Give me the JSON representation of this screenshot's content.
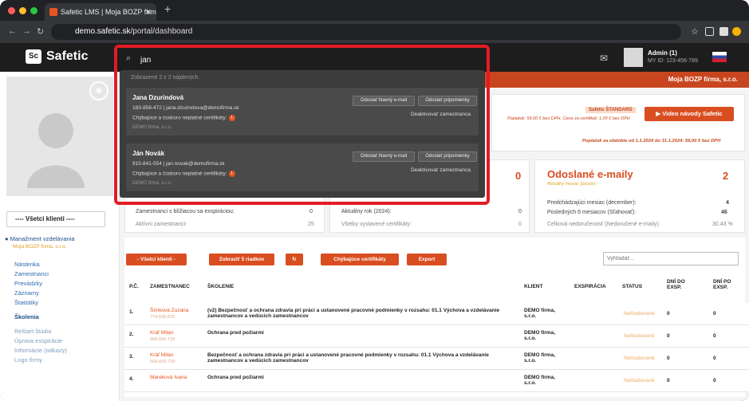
{
  "browser": {
    "tab_title": "Safetic LMS | Moja BOZP firm",
    "url_domain": "demo.safetic.sk",
    "url_path": "/portal/dashboard"
  },
  "header": {
    "logo": "Safetic",
    "admin_name": "Admin (1)",
    "admin_id": "MY ID: 123-456-789",
    "company": "Moja BOZP firma, s.r.o."
  },
  "search": {
    "query": "jan",
    "found_text": "Zobrazené 2 z 2 nájdených.",
    "results": [
      {
        "name": "Jana Dzurindová",
        "contact": "183-858-472 | jana.dzurindova@demofirma.sk",
        "certs_label": "Chýbajúce a čoskoro neplatné certifikáty:",
        "badge": "1",
        "company": "DEMO firma, s.r.o.",
        "btn_email": "Odoslať hlavný e-mail",
        "btn_reminder": "Odoslať pripomienky",
        "deactivate": "Deaktivovať zamestnanca"
      },
      {
        "name": "Ján Novák",
        "contact": "915-841-554 | jan.novak@demofirma.sk",
        "certs_label": "Chýbajúce a čoskoro neplatné certifikáty:",
        "badge": "1",
        "company": "DEMO firma, s.r.o.",
        "btn_email": "Odoslať hlavný e-mail",
        "btn_reminder": "Odoslať pripomienky",
        "deactivate": "Deaktivovať zamestnanca"
      }
    ]
  },
  "sidebar": {
    "client_select": "---- Všetci klienti ----",
    "mgmt_title": "Manažment vzdelávania",
    "mgmt_sub": "Moja BOZP firma, s.r.o.",
    "nav": [
      "Nástenka",
      "Zamestnanci",
      "Prevádzky",
      "Záznamy",
      "Štatistiky",
      "Školenia",
      "Reštart štúdia",
      "Úprava exspirácie",
      "Informácie (odkazy)",
      "Logo firmy"
    ]
  },
  "summary": {
    "package": "Safetic ŠTANDARD",
    "video_btn": "Video návody Safetic",
    "fee_line": "Poplatok: 59,00 € bez DPH, Cena za certifikát: 1,00 € bez DPH",
    "period_line": "Poplatok za obdobie od 1.1.2024 do 31.1.2024: 59,00 € bez DPH",
    "left_count": "0",
    "emails_title": "Odoslané e-maily",
    "emails_count": "2",
    "emails_sub": "Aktuálny mesiac (január)",
    "rows_left": [
      {
        "label": "Zamestnanci s blížiacou sa exspiráciou:",
        "value": "0"
      },
      {
        "label": "Aktívni zamestnanci:",
        "value": "25"
      }
    ],
    "rows_mid": [
      {
        "label": "Aktuálny rok (2024):",
        "value": "0"
      },
      {
        "label": "Všetky vystavené certifikáty:",
        "value": "0"
      }
    ],
    "rows_right": [
      {
        "label": "Predchádzajúci mesiac (december):",
        "value": "4"
      },
      {
        "label": "Posledných 6 mesiacov (Sťahovať):",
        "value": "46"
      },
      {
        "label": "Celková nedoručenosť (Nedoručené e-maily):",
        "value": "30.43 %"
      }
    ]
  },
  "toolbar": {
    "clients": "- Všetci klienti -",
    "show_rows": "Zobraziť 5 riadkov",
    "refresh": "↻",
    "missing": "Chýbajúce certifikáty",
    "export": "Export",
    "search_placeholder": "Vyhľadať..."
  },
  "table": {
    "headers": [
      "P.Č.",
      "ZAMESTNANEC",
      "ŠKOLENIE",
      "KLIENT",
      "EXSPIRÁCIA",
      "STATUS",
      "DNÍ DO EXSP.",
      "DNÍ PO EXSP."
    ],
    "rows": [
      {
        "num": "1.",
        "name": "Šimková Zuzana",
        "phone": "774-535-875",
        "training": "(v2) Bezpečnosť a ochrana zdravia pri práci a ustanovené pracovné podmienky v rozsahu: 01.1 Výchova a vzdelávanie zamestnancov a vedúcich zamestnancov",
        "client": "DEMO firma, s.r.o.",
        "status": "Neštudované",
        "do": "0",
        "po": "0"
      },
      {
        "num": "2.",
        "name": "Kráľ Milan",
        "phone": "568-820-718",
        "training": "Ochrana pred požiarmi",
        "client": "DEMO firma, s.r.o.",
        "status": "Neštudované",
        "do": "0",
        "po": "0"
      },
      {
        "num": "3.",
        "name": "Kráľ Milan",
        "phone": "568-820-718",
        "training": "Bezpečnosť a ochrana zdravia pri práci a ustanovené pracovné podmienky v rozsahu: 01.1 Výchova a vzdelávanie zamestnancov a vedúcich zamestnancov",
        "client": "DEMO firma, s.r.o.",
        "status": "Neštudované",
        "do": "0",
        "po": "0"
      },
      {
        "num": "4.",
        "name": "Mareková Ivana",
        "phone": "",
        "training": "Ochrana pred požiarmi",
        "client": "DEMO firma, s.r.o.",
        "status": "Neštudované",
        "do": "0",
        "po": "0"
      }
    ]
  }
}
